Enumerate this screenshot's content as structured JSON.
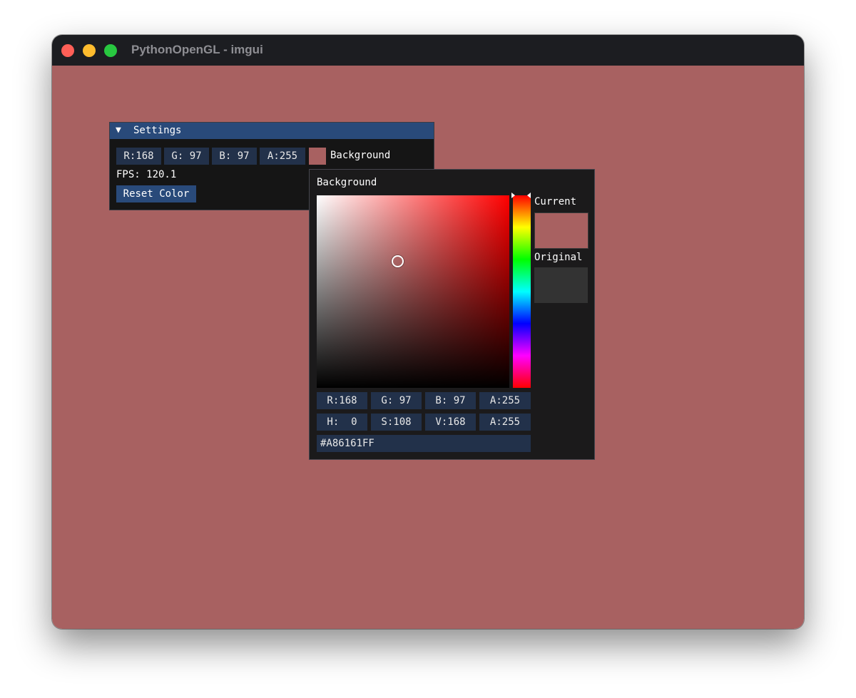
{
  "window": {
    "title": "PythonOpenGL - imgui"
  },
  "colors": {
    "background": "#A86161",
    "original": "#333333",
    "panel_header": "#294A7A",
    "frame": "#22314A"
  },
  "settings_panel": {
    "title": "Settings",
    "collapse_icon": "triangle-down-icon",
    "channels": [
      "R:168",
      "G: 97",
      "B: 97",
      "A:255"
    ],
    "color_label": "Background",
    "fps": "FPS: 120.1",
    "reset_button": "Reset Color"
  },
  "color_picker": {
    "title": "Background",
    "current_label": "Current",
    "original_label": "Original",
    "rgba_fields": [
      "R:168",
      "G: 97",
      "B: 97",
      "A:255"
    ],
    "hsva_fields": [
      "H:  0",
      "S:108",
      "V:168",
      "A:255"
    ],
    "hex": "#A86161FF"
  }
}
